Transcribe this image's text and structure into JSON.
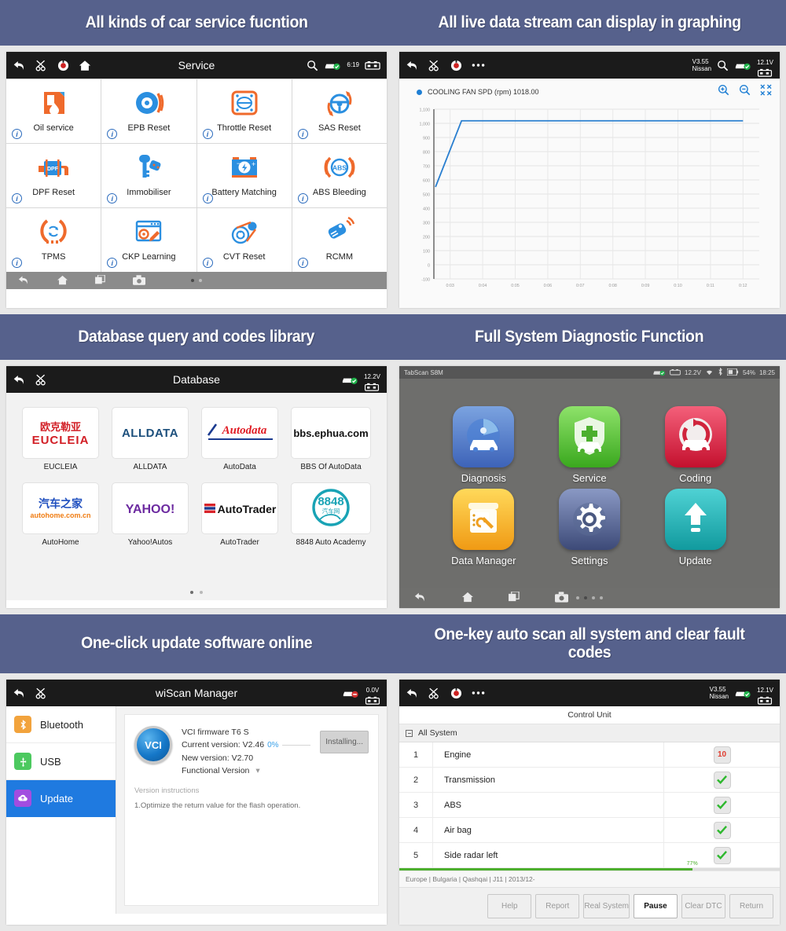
{
  "banners": {
    "service": "All kinds of car service fucntion",
    "graphing": "All live data stream can display in graphing",
    "database": "Database query and codes library",
    "fullsystem": "Full System Diagnostic Function",
    "update": "One-click update software online",
    "autoscan": "One-key auto scan all system and clear fault codes"
  },
  "service_panel": {
    "title": "Service",
    "status": {
      "time": "6:19"
    },
    "items": [
      {
        "label": "Oil service",
        "icon": "oil-can-icon"
      },
      {
        "label": "EPB Reset",
        "icon": "brake-icon"
      },
      {
        "label": "Throttle Reset",
        "icon": "throttle-icon"
      },
      {
        "label": "SAS Reset",
        "icon": "steering-wheel-icon"
      },
      {
        "label": "DPF Reset",
        "icon": "dpf-filter-icon"
      },
      {
        "label": "Immobiliser",
        "icon": "car-key-icon"
      },
      {
        "label": "Battery Matching",
        "icon": "battery-icon"
      },
      {
        "label": "ABS Bleeding",
        "icon": "abs-icon"
      },
      {
        "label": "TPMS",
        "icon": "tyre-pressure-icon"
      },
      {
        "label": "CKP Learning",
        "icon": "gear-pencil-icon"
      },
      {
        "label": "CVT Reset",
        "icon": "pulley-belt-icon"
      },
      {
        "label": "RCMM",
        "icon": "remote-key-icon"
      }
    ]
  },
  "graph_panel": {
    "version": "V3.55",
    "make": "Nissan",
    "voltage": "12.1V",
    "legend_label": "COOLING FAN SPD (rpm) 1018.00",
    "chart_data": {
      "type": "line",
      "title": "COOLING FAN SPD (rpm) 1018.00",
      "xlabel": "",
      "ylabel": "rpm",
      "series": [
        {
          "name": "COOLING FAN SPD (rpm)",
          "color": "#2a7fd0",
          "x": [
            2.55,
            3.35,
            4.0,
            5.0,
            6.0,
            7.0,
            8.0,
            9.0,
            10.0,
            11.0,
            12.0
          ],
          "values": [
            550,
            1018,
            1018,
            1018,
            1018,
            1018,
            1018,
            1018,
            1018,
            1018,
            1018
          ]
        }
      ],
      "x_ticks": [
        "0:03",
        "0:04",
        "0:05",
        "0:06",
        "0:07",
        "0:08",
        "0:09",
        "0:10",
        "0:11",
        "0:12"
      ],
      "y_ticks": [
        "1,100",
        "1,000",
        "900",
        "800",
        "700",
        "600",
        "500",
        "400",
        "300",
        "200",
        "100",
        "0",
        "-100"
      ],
      "ylim": [
        -100,
        1100
      ],
      "xlim": [
        2.5,
        12.5
      ],
      "grid": true,
      "legend": "top-left"
    }
  },
  "database_panel": {
    "title": "Database",
    "voltage": "12.2V",
    "items": [
      {
        "label": "EUCLEIA",
        "logo": "eucleia-logo"
      },
      {
        "label": "ALLDATA",
        "logo": "alldata-logo"
      },
      {
        "label": "AutoData",
        "logo": "autodata-logo"
      },
      {
        "label": "BBS Of AutoData",
        "logo": "bbs-ephua-logo"
      },
      {
        "label": "AutoHome",
        "logo": "autohome-logo"
      },
      {
        "label": "Yahoo!Autos",
        "logo": "yahoo-logo"
      },
      {
        "label": "AutoTrader",
        "logo": "autotrader-logo"
      },
      {
        "label": "8848 Auto Academy",
        "logo": "8848-logo"
      }
    ],
    "logo_text": {
      "eucleia_cn": "欧 克 勒 亚",
      "eucleia_en": "EUCLEIA",
      "alldata": "ALLDATA",
      "autodata": "Autodata",
      "bbs": "bbs.ephua.com",
      "autohome_cn": "汽车之家",
      "autohome_url": "autohome.com.cn",
      "yahoo": "YAHOO!",
      "autotrader": "AutoTrader",
      "n8848": "8848",
      "n8848_cn": "汽车网"
    }
  },
  "fullsystem_panel": {
    "device_name": "TabScan S8M",
    "voltage": "12.2V",
    "battery": "54%",
    "time": "18:25",
    "items": [
      {
        "label": "Diagnosis",
        "icon": "radar-car-icon",
        "color": "#4a7fd4"
      },
      {
        "label": "Service",
        "icon": "shield-cross-icon",
        "color": "#5cc63c"
      },
      {
        "label": "Coding",
        "icon": "refresh-car-icon",
        "color": "#e0304a"
      },
      {
        "label": "Data Manager",
        "icon": "folder-tools-icon",
        "color": "#f5b820"
      },
      {
        "label": "Settings",
        "icon": "gear-icon",
        "color": "#5a6a94"
      },
      {
        "label": "Update",
        "icon": "upload-arrow-icon",
        "color": "#23b2b6"
      }
    ]
  },
  "update_panel": {
    "title": "wiScan Manager",
    "voltage": "0.0V",
    "sidebar": [
      {
        "label": "Bluetooth",
        "icon": "bluetooth-icon",
        "color": "#f2a33c",
        "active": false
      },
      {
        "label": "USB",
        "icon": "usb-icon",
        "color": "#4cc95f",
        "active": false
      },
      {
        "label": "Update",
        "icon": "cloud-update-icon",
        "color": "#a24de0",
        "active": true
      }
    ],
    "card": {
      "badge": "VCI",
      "firmware": "VCI firmware T6 S",
      "current_version": "Current version: V2.46",
      "new_version": "New version: V2.70",
      "functional_version": "Functional Version",
      "progress_pct": "0%",
      "action_button": "Installing...",
      "note_title": "Version  instructions",
      "note_line": "1.Optimize the return value for the flash operation."
    }
  },
  "autoscan_panel": {
    "version": "V3.55",
    "make": "Nissan",
    "voltage": "12.1V",
    "subtitle": "Control Unit",
    "group_label": "All System",
    "rows": [
      {
        "index": "1",
        "name": "Engine",
        "status": "10",
        "state": "error"
      },
      {
        "index": "2",
        "name": "Transmission",
        "status": "✔",
        "state": "ok"
      },
      {
        "index": "3",
        "name": "ABS",
        "status": "✔",
        "state": "ok"
      },
      {
        "index": "4",
        "name": "Air bag",
        "status": "✔",
        "state": "ok"
      },
      {
        "index": "5",
        "name": "Side radar left",
        "status": "✔",
        "state": "ok"
      }
    ],
    "progress": "77%",
    "progress_value": 77,
    "breadcrumb": "Europe | Bulgaria | Qashqai | J11 | 2013/12-",
    "buttons": [
      {
        "label": "Help",
        "primary": false
      },
      {
        "label": "Report",
        "primary": false
      },
      {
        "label": "Real System",
        "primary": false
      },
      {
        "label": "Pause",
        "primary": true
      },
      {
        "label": "Clear DTC",
        "primary": false
      },
      {
        "label": "Return",
        "primary": false
      }
    ]
  }
}
